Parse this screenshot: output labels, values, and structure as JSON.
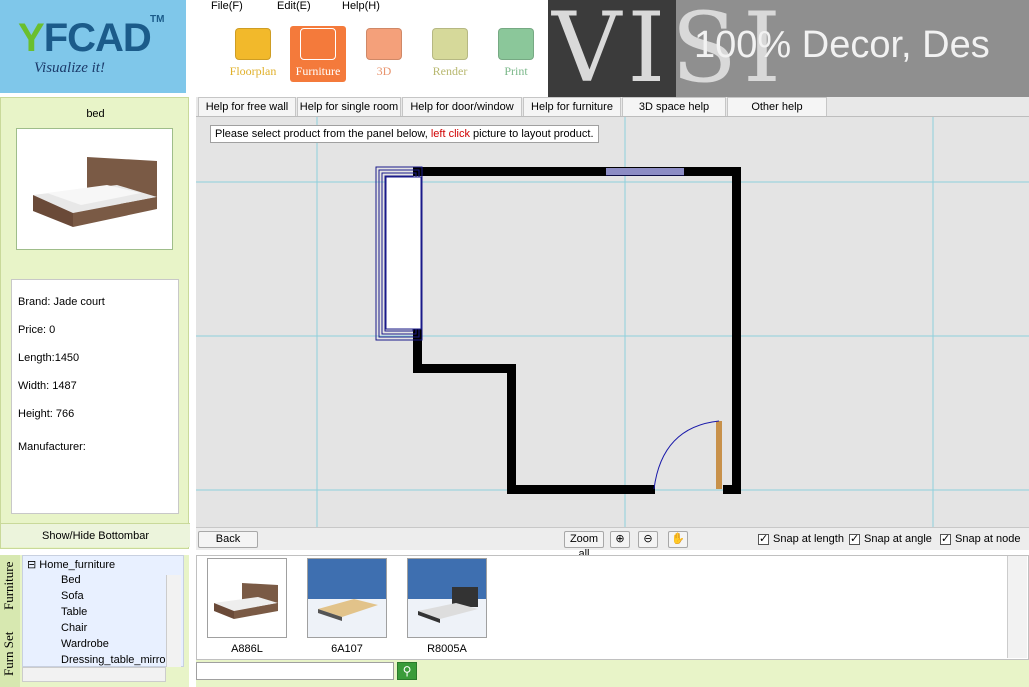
{
  "logo": {
    "brand_y": "Y",
    "brand_rest": "FCAD",
    "tm": "TM",
    "tagline": "Visualize it!"
  },
  "menu": [
    {
      "label": "File(F)"
    },
    {
      "label": "Edit(E)"
    },
    {
      "label": "Help(H)"
    }
  ],
  "toolbar": [
    {
      "label": "Floorplan",
      "icon": "pencil-icon",
      "color": "#f2b92b",
      "active": false
    },
    {
      "label": "Furniture",
      "icon": "chair-icon",
      "color": "#f47a3b",
      "active": true
    },
    {
      "label": "3D",
      "icon": "cube-icon",
      "color": "#f4a07a",
      "active": false
    },
    {
      "label": "Render",
      "icon": "camera-icon",
      "color": "#d6d99a",
      "active": false
    },
    {
      "label": "Print",
      "icon": "printer-icon",
      "color": "#8bc79a",
      "active": false
    }
  ],
  "banner": {
    "big": "VISI",
    "text": "100% Decor, Des"
  },
  "item": {
    "title": "bed",
    "brand": "Brand: Jade court",
    "price": "Price: 0",
    "length": "Length:1450",
    "width": "Width:  1487",
    "height": "Height: 766",
    "manufacturer": "Manufacturer:"
  },
  "show_hide_label": "Show/Hide Bottombar",
  "help_tabs": [
    "Help for free wall",
    "Help for single room",
    "Help for door/window",
    "Help for furniture",
    "3D space help",
    "Other help"
  ],
  "instruction": {
    "before": "Please select product from the panel below, ",
    "highlight": "left click",
    "after": " picture to layout product."
  },
  "canvas_toolbar": {
    "back": "Back",
    "zoom_all": "Zoom all",
    "snap_length": "Snap at length",
    "snap_angle": "Snap at angle",
    "snap_node": "Snap at node"
  },
  "tree": {
    "vtab_furniture": "Furniture",
    "vtab_furnset": "Furn Set",
    "root": "Home_furniture",
    "items": [
      "Bed",
      "Sofa",
      "Table",
      "Chair",
      "Wardrobe",
      "Dressing_table_mirror"
    ]
  },
  "products": [
    {
      "code": "A886L"
    },
    {
      "code": "6A107"
    },
    {
      "code": "R8005A"
    }
  ],
  "colors": {
    "accent": "#f47a3b",
    "panel_green": "#e8f4c8",
    "grid": "#8ed0dc",
    "wall": "#000000",
    "door": "#c8914a"
  }
}
